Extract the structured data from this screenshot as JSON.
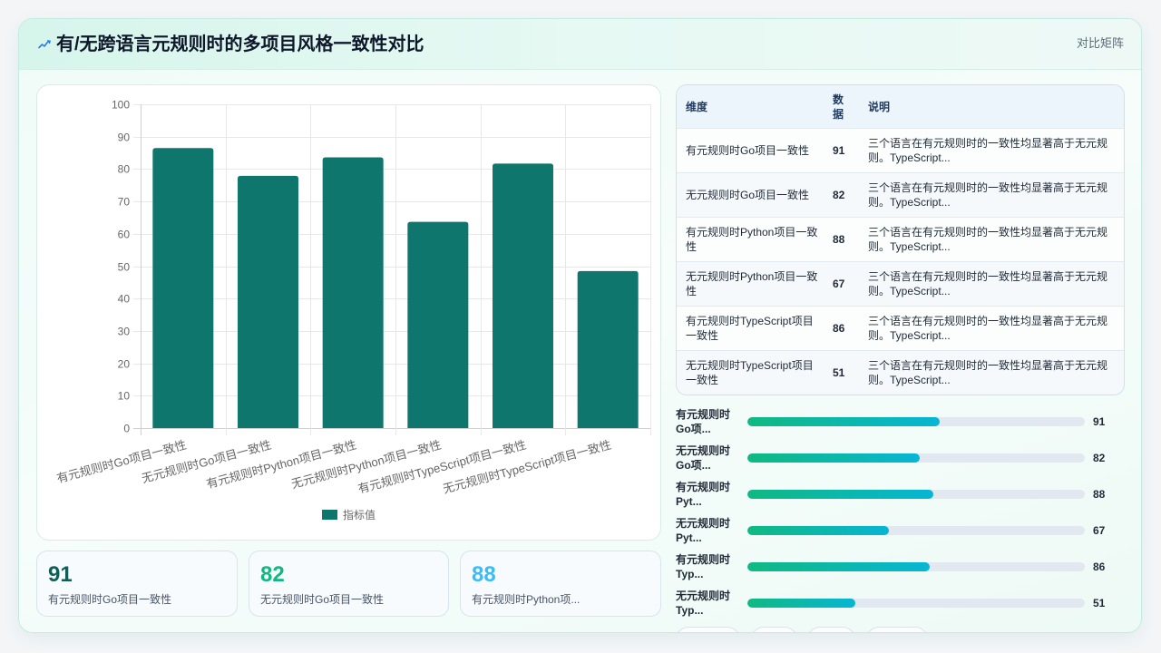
{
  "header": {
    "icon": "pulse-icon",
    "title": "有/无跨语言元规则时的多项目风格一致性对比",
    "right_label": "对比矩阵"
  },
  "theme": {
    "progress_gradient": [
      "#10b981",
      "#06b6d4"
    ]
  },
  "chart_data": {
    "type": "bar",
    "categories": [
      "有元规则时Go项目一致性",
      "无元规则时Go项目一致性",
      "有元规则时Python项目一致性",
      "无元规则时Python项目一致性",
      "有元规则时TypeScript项目一致性",
      "无元规则时TypeScript项目一致性"
    ],
    "series": [
      {
        "name": "指标值",
        "values": [
          86.5,
          77.9,
          83.6,
          63.7,
          81.7,
          48.5
        ],
        "color": "#0f766e"
      }
    ],
    "ylim": [
      0,
      100
    ],
    "yticks": [
      0,
      10,
      20,
      30,
      40,
      50,
      60,
      70,
      80,
      90,
      100
    ],
    "grid": true,
    "legend_position": "bottom"
  },
  "stats": [
    {
      "value": "91",
      "label": "有元规则时Go项目一致性",
      "color": "#115e59"
    },
    {
      "value": "82",
      "label": "无元规则时Go项目一致性",
      "color": "#10b981"
    },
    {
      "value": "88",
      "label": "有元规则时Python项...",
      "color": "#38bdf8"
    }
  ],
  "table": {
    "columns": [
      "维度",
      "数据",
      "说明"
    ],
    "rows": [
      {
        "dimension": "有元规则时Go项目一致性",
        "value": "91",
        "note": "三个语言在有元规则时的一致性均显著高于无元规则。TypeScript..."
      },
      {
        "dimension": "无元规则时Go项目一致性",
        "value": "82",
        "note": "三个语言在有元规则时的一致性均显著高于无元规则。TypeScript..."
      },
      {
        "dimension": "有元规则时Python项目一致性",
        "value": "88",
        "note": "三个语言在有元规则时的一致性均显著高于无元规则。TypeScript..."
      },
      {
        "dimension": "无元规则时Python项目一致性",
        "value": "67",
        "note": "三个语言在有元规则时的一致性均显著高于无元规则。TypeScript..."
      },
      {
        "dimension": "有元规则时TypeScript项目一致性",
        "value": "86",
        "note": "三个语言在有元规则时的一致性均显著高于无元规则。TypeScript..."
      },
      {
        "dimension": "无元规则时TypeScript项目一致性",
        "value": "51",
        "note": "三个语言在有元规则时的一致性均显著高于无元规则。TypeScript..."
      }
    ]
  },
  "progress": [
    {
      "label": "有元规则时Go项...",
      "value": "91",
      "fill_pct": 57
    },
    {
      "label": "无元规则时Go项...",
      "value": "82",
      "fill_pct": 51
    },
    {
      "label": "有元规则时Pyt...",
      "value": "88",
      "fill_pct": 55
    },
    {
      "label": "无元规则时Pyt...",
      "value": "67",
      "fill_pct": 42
    },
    {
      "label": "有元规则时Typ...",
      "value": "86",
      "fill_pct": 54
    },
    {
      "label": "无元规则时Typ...",
      "value": "51",
      "fill_pct": 32
    }
  ]
}
